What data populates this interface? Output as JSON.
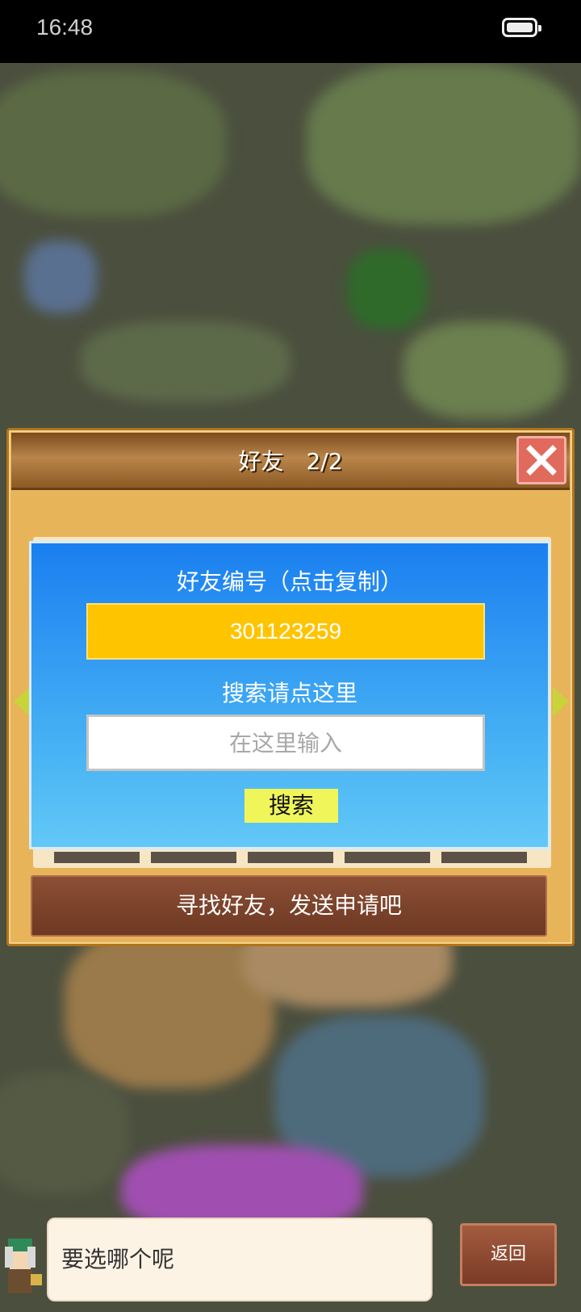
{
  "status_bar": {
    "time": "16:48",
    "battery_icon": "battery-icon"
  },
  "dialog": {
    "title": "好友　2/2",
    "close_icon": "close-icon",
    "friend_id_label": "好友编号（点击复制）",
    "friend_id": "301123259",
    "search_label": "搜索请点这里",
    "search_placeholder": "在这里输入",
    "search_button": "搜索",
    "send_request_button": "寻找好友，发送申请吧"
  },
  "bottom": {
    "message": "要选哪个呢",
    "back_button": "返回"
  },
  "colors": {
    "panel_blue": "#1a7ff0",
    "id_box": "#ffc400",
    "search_button": "#f0f65a",
    "close_red": "#e06a5c"
  }
}
